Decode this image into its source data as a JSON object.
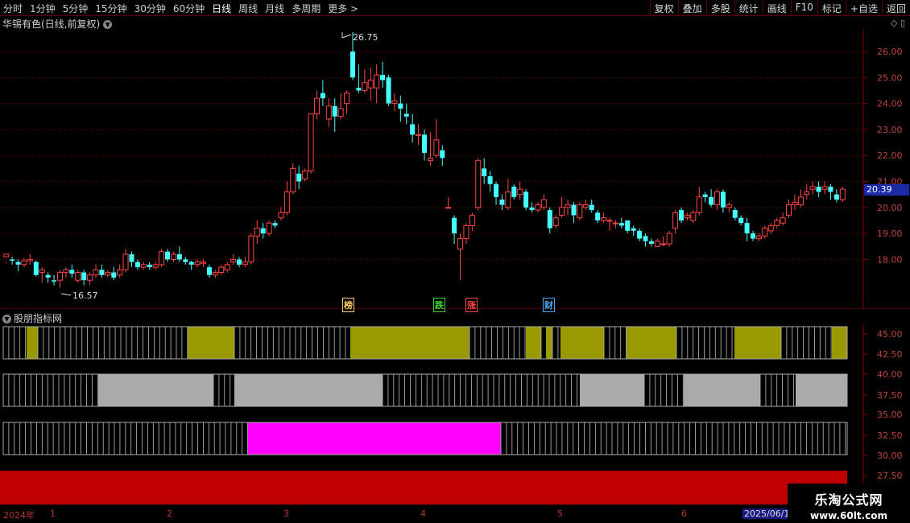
{
  "toolbar": {
    "periods": [
      "分时",
      "1分钟",
      "5分钟",
      "15分钟",
      "30分钟",
      "60分钟",
      "日线",
      "周线",
      "月线",
      "多周期",
      "更多 >"
    ],
    "active_period": "日线",
    "actions": [
      "复权",
      "叠加",
      "多股",
      "统计",
      "画线",
      "F10",
      "标记",
      "+自选",
      "返回"
    ]
  },
  "stock_title": "华锡有色(日线,前复权)",
  "sub_title": "股朋指标网",
  "price_tag": "20.39",
  "annotations": {
    "high_label": "26.75",
    "low_label": "16.57"
  },
  "markers": [
    {
      "text": "榜",
      "color": "#ffcc66"
    },
    {
      "text": "跌",
      "color": "#33dd33"
    },
    {
      "text": "涨",
      "color": "#ff4444"
    },
    {
      "text": "财",
      "color": "#44aaff"
    }
  ],
  "date_axis": {
    "year_label": "2024年",
    "months": [
      "1",
      "2",
      "3",
      "4",
      "5",
      "6"
    ],
    "current_date": "2025/06/1"
  },
  "watermark": {
    "title": "乐淘公式网",
    "url": "www.60lt.com"
  },
  "colors": {
    "up": "#ff4444",
    "down": "#44ffff",
    "yellow_band": "#999900",
    "gray_band": "#aaaaaa",
    "magenta_band": "#ff00ff",
    "red_band": "#c00000",
    "grid": "#8b0000"
  },
  "chart_data": {
    "type": "candlestick",
    "y_axis_ticks": [
      "26.00",
      "25.00",
      "24.00",
      "23.00",
      "22.00",
      "21.00",
      "20.00",
      "19.00",
      "18.00"
    ],
    "ylim": [
      17.0,
      26.9
    ],
    "sub_axis_ticks": [
      "45.00",
      "42.50",
      "40.00",
      "37.50",
      "35.00",
      "32.50",
      "30.00",
      "27.50"
    ],
    "candles": [
      [
        18.1,
        18.2,
        17.9,
        17.85
      ],
      [
        18.0,
        17.95,
        18.1,
        17.8
      ],
      [
        17.9,
        17.8,
        18.0,
        17.55
      ],
      [
        17.8,
        17.95,
        18.05,
        17.7
      ],
      [
        17.95,
        18.0,
        18.2,
        17.8
      ],
      [
        17.9,
        17.4,
        17.95,
        17.35
      ],
      [
        17.5,
        17.6,
        17.7,
        17.1
      ],
      [
        17.4,
        17.3,
        17.5,
        17.1
      ],
      [
        17.2,
        17.15,
        17.4,
        17.0
      ],
      [
        17.2,
        17.5,
        17.6,
        16.9
      ],
      [
        17.5,
        17.6,
        17.7,
        17.3
      ],
      [
        17.6,
        17.45,
        17.8,
        17.3
      ],
      [
        17.2,
        17.5,
        17.6,
        17.1
      ],
      [
        17.5,
        17.2,
        17.6,
        17.0
      ],
      [
        17.2,
        17.4,
        17.5,
        17.0
      ],
      [
        17.4,
        17.6,
        17.8,
        17.3
      ],
      [
        17.6,
        17.4,
        17.8,
        17.3
      ],
      [
        17.4,
        17.5,
        17.6,
        17.3
      ],
      [
        17.5,
        17.3,
        17.7,
        17.2
      ],
      [
        17.4,
        17.6,
        17.8,
        17.3
      ],
      [
        17.6,
        18.2,
        18.4,
        17.5
      ],
      [
        18.2,
        17.9,
        18.3,
        17.7
      ],
      [
        17.9,
        17.7,
        18.0,
        17.6
      ],
      [
        17.7,
        17.8,
        17.9,
        17.6
      ],
      [
        17.8,
        17.7,
        17.9,
        17.6
      ],
      [
        17.7,
        17.8,
        17.9,
        17.6
      ],
      [
        17.8,
        18.3,
        18.4,
        17.7
      ],
      [
        18.3,
        18.0,
        18.4,
        17.9
      ],
      [
        18.0,
        18.2,
        18.3,
        17.9
      ],
      [
        18.2,
        18.0,
        18.5,
        17.9
      ],
      [
        18.0,
        17.9,
        18.1,
        17.8
      ],
      [
        17.9,
        17.8,
        17.95,
        17.6
      ],
      [
        17.8,
        17.9,
        18.0,
        17.7
      ],
      [
        17.85,
        17.9,
        18.0,
        17.7
      ],
      [
        17.7,
        17.4,
        17.8,
        17.3
      ],
      [
        17.4,
        17.5,
        17.6,
        17.3
      ],
      [
        17.5,
        17.7,
        17.8,
        17.4
      ],
      [
        17.6,
        17.8,
        17.9,
        17.5
      ],
      [
        17.9,
        18.0,
        18.2,
        17.8
      ],
      [
        18.0,
        17.8,
        18.1,
        17.7
      ],
      [
        17.8,
        17.9,
        18.1,
        17.7
      ],
      [
        17.9,
        18.9,
        19.0,
        17.8
      ],
      [
        18.9,
        19.2,
        19.5,
        18.6
      ],
      [
        19.2,
        19.0,
        19.4,
        18.8
      ],
      [
        19.0,
        19.4,
        19.5,
        18.9
      ],
      [
        19.4,
        19.3,
        19.5,
        19.2
      ],
      [
        19.6,
        19.8,
        20.0,
        19.5
      ],
      [
        19.8,
        20.6,
        21.0,
        19.7
      ],
      [
        20.6,
        21.5,
        21.7,
        20.5
      ],
      [
        21.3,
        21.0,
        21.6,
        20.7
      ],
      [
        21.1,
        21.4,
        21.5,
        21.0
      ],
      [
        21.4,
        23.6,
        23.6,
        21.3
      ],
      [
        23.6,
        24.2,
        24.5,
        23.4
      ],
      [
        24.4,
        24.2,
        24.9,
        23.9
      ],
      [
        23.4,
        23.9,
        24.2,
        23.1
      ],
      [
        23.9,
        23.5,
        24.2,
        22.9
      ],
      [
        23.5,
        23.8,
        24.4,
        23.4
      ],
      [
        24.0,
        24.4,
        24.5,
        23.6
      ],
      [
        26.0,
        25.0,
        26.75,
        24.9
      ],
      [
        24.6,
        24.5,
        25.5,
        24.4
      ],
      [
        24.5,
        24.8,
        25.3,
        24.4
      ],
      [
        24.6,
        24.9,
        25.4,
        24.1
      ],
      [
        24.6,
        25.1,
        25.5,
        24.0
      ],
      [
        25.1,
        24.9,
        25.6,
        24.6
      ],
      [
        25.0,
        24.0,
        25.1,
        23.9
      ],
      [
        24.0,
        24.1,
        24.4,
        23.7
      ],
      [
        24.0,
        23.8,
        24.3,
        23.3
      ],
      [
        23.6,
        23.5,
        24.0,
        23.2
      ],
      [
        23.2,
        22.8,
        23.6,
        22.5
      ],
      [
        22.8,
        22.8,
        23.2,
        22.4
      ],
      [
        22.8,
        22.1,
        23.0,
        21.8
      ],
      [
        21.8,
        21.9,
        22.9,
        21.6
      ],
      [
        22.0,
        22.6,
        23.4,
        21.9
      ],
      [
        22.2,
        21.9,
        22.4,
        21.6
      ],
      [
        20.0,
        20.0,
        20.4,
        20.0
      ],
      [
        19.6,
        19.0,
        19.7,
        18.6
      ],
      [
        18.4,
        18.8,
        19.0,
        17.2
      ],
      [
        18.8,
        19.3,
        19.4,
        18.6
      ],
      [
        19.3,
        19.7,
        19.8,
        19.1
      ],
      [
        20.0,
        21.8,
        21.9,
        19.9
      ],
      [
        21.5,
        21.2,
        21.9,
        20.9
      ],
      [
        21.2,
        20.9,
        21.4,
        20.6
      ],
      [
        20.9,
        20.4,
        21.0,
        20.1
      ],
      [
        20.3,
        20.1,
        20.5,
        19.9
      ],
      [
        20.0,
        20.6,
        21.1,
        19.9
      ],
      [
        20.8,
        20.4,
        20.9,
        20.3
      ],
      [
        20.5,
        20.7,
        21.0,
        20.3
      ],
      [
        20.6,
        20.0,
        20.7,
        19.9
      ],
      [
        20.0,
        19.9,
        20.2,
        19.8
      ],
      [
        19.9,
        20.1,
        20.2,
        19.8
      ],
      [
        20.0,
        20.3,
        20.5,
        19.9
      ],
      [
        19.9,
        19.2,
        20.0,
        19.0
      ],
      [
        19.3,
        19.6,
        19.7,
        19.2
      ],
      [
        19.7,
        20.0,
        20.4,
        19.6
      ],
      [
        20.0,
        20.1,
        20.3,
        19.7
      ],
      [
        20.1,
        19.7,
        20.2,
        19.4
      ],
      [
        19.6,
        20.1,
        20.2,
        19.5
      ],
      [
        20.0,
        20.1,
        20.3,
        19.9
      ],
      [
        20.1,
        19.9,
        20.3,
        19.8
      ],
      [
        19.8,
        19.5,
        19.9,
        19.4
      ],
      [
        19.5,
        19.6,
        19.8,
        19.4
      ],
      [
        19.5,
        19.5,
        19.6,
        19.1
      ],
      [
        19.4,
        19.4,
        19.5,
        19.2
      ],
      [
        19.4,
        19.3,
        19.6,
        19.2
      ],
      [
        19.5,
        19.1,
        19.5,
        19.0
      ],
      [
        19.2,
        19.1,
        19.3,
        18.9
      ],
      [
        19.1,
        18.8,
        19.2,
        18.7
      ],
      [
        18.9,
        18.7,
        19.0,
        18.5
      ],
      [
        18.7,
        18.6,
        18.8,
        18.5
      ],
      [
        18.5,
        18.7,
        18.8,
        18.5
      ],
      [
        18.6,
        18.6,
        18.9,
        18.5
      ],
      [
        18.6,
        19.0,
        19.1,
        18.5
      ],
      [
        19.2,
        19.8,
        19.9,
        19.0
      ],
      [
        19.9,
        19.5,
        20.0,
        19.4
      ],
      [
        19.6,
        19.7,
        19.8,
        19.5
      ],
      [
        19.5,
        19.8,
        19.9,
        19.4
      ],
      [
        19.8,
        20.4,
        20.8,
        19.7
      ],
      [
        20.5,
        20.4,
        20.6,
        20.2
      ],
      [
        20.4,
        20.1,
        20.7,
        20.0
      ],
      [
        20.1,
        20.6,
        20.7,
        19.9
      ],
      [
        20.6,
        20.0,
        20.7,
        19.8
      ],
      [
        20.0,
        20.1,
        20.2,
        19.8
      ],
      [
        19.9,
        19.6,
        20.0,
        19.5
      ],
      [
        19.6,
        19.4,
        19.7,
        19.3
      ],
      [
        19.4,
        19.0,
        19.6,
        18.7
      ],
      [
        19.0,
        18.8,
        19.1,
        18.7
      ],
      [
        18.8,
        18.9,
        19.0,
        18.7
      ],
      [
        18.9,
        19.2,
        19.3,
        18.8
      ],
      [
        19.1,
        19.3,
        19.4,
        19.0
      ],
      [
        19.3,
        19.5,
        19.6,
        19.2
      ],
      [
        19.4,
        19.6,
        19.8,
        19.3
      ],
      [
        19.7,
        20.1,
        20.3,
        19.6
      ],
      [
        20.1,
        20.2,
        20.5,
        19.9
      ],
      [
        20.1,
        20.4,
        20.7,
        20.0
      ],
      [
        20.5,
        20.6,
        20.9,
        20.3
      ],
      [
        20.7,
        20.8,
        21.0,
        20.5
      ],
      [
        20.8,
        20.6,
        21.0,
        20.4
      ],
      [
        20.7,
        20.8,
        21.0,
        20.5
      ],
      [
        20.8,
        20.6,
        20.9,
        20.3
      ],
      [
        20.5,
        20.3,
        20.7,
        20.2
      ],
      [
        20.3,
        20.7,
        20.8,
        20.2
      ]
    ],
    "indicator_bands": [
      {
        "name": "band1",
        "color": "#999900",
        "on": [
          0,
          1,
          0,
          0,
          1,
          0,
          1,
          0,
          1,
          0,
          1,
          0,
          1,
          0,
          1,
          0,
          1
        ]
      },
      {
        "name": "band2",
        "color": "#aaaaaa",
        "on": [
          0,
          1,
          0,
          1,
          0,
          1,
          0,
          1,
          0,
          1
        ]
      },
      {
        "name": "band3",
        "color": "#ff00ff",
        "on": [
          0,
          1,
          0
        ]
      },
      {
        "name": "band4",
        "color": "#c00000",
        "on": [
          1
        ]
      }
    ]
  }
}
